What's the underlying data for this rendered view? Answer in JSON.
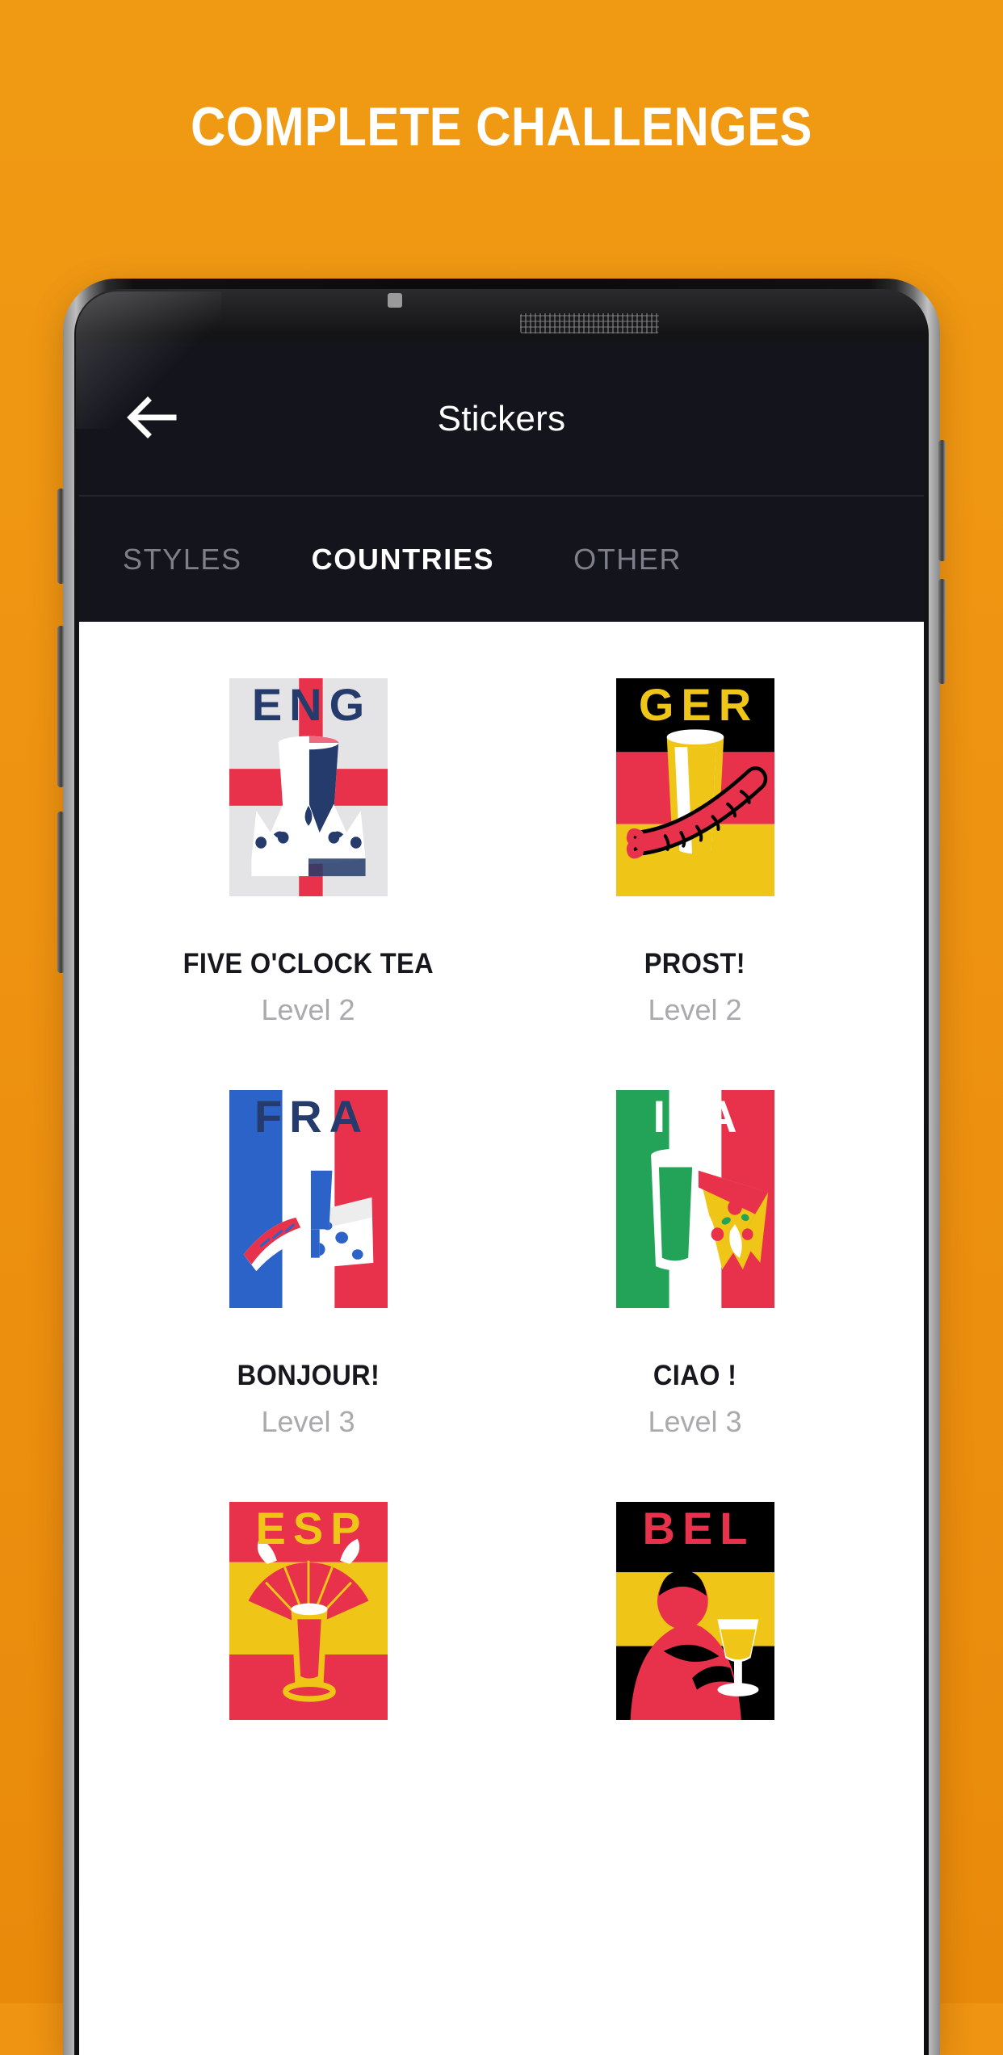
{
  "promo": {
    "headline": "COMPLETE CHALLENGES",
    "background_color": "#EE9312"
  },
  "app_bar": {
    "back_icon": "arrow-left-icon",
    "title": "Stickers",
    "background_color": "#14151C"
  },
  "tabs": [
    {
      "label": "STYLES",
      "active": false
    },
    {
      "label": "COUNTRIES",
      "active": true
    },
    {
      "label": "OTHER",
      "active": false
    }
  ],
  "stickers": [
    {
      "code": "ENG",
      "title": "FIVE O'CLOCK TEA",
      "level": "Level 2",
      "border_color": "#253B6B",
      "code_color": "#253B6B",
      "flag": "england",
      "bg_color": "#E4E4E6",
      "accent_color": "#E8324B"
    },
    {
      "code": "GER",
      "title": "PROST!",
      "level": "Level 2",
      "border_color": "#000000",
      "code_color": "#EFC517",
      "flag": "germany",
      "bg_color": "#000000",
      "accent_color": "#E8324B"
    },
    {
      "code": "FRA",
      "title": "BONJOUR!",
      "level": "Level 3",
      "border_color": "#253B6B",
      "code_color": "#253B6B",
      "flag": "france",
      "bg_color": "#2C63C8",
      "accent_color": "#E8324B"
    },
    {
      "code": "ITA",
      "title": "CIAO !",
      "level": "Level 3",
      "border_color": "#E8324B",
      "code_color": "#FFFFFF",
      "flag": "italy",
      "bg_color": "#22A357",
      "accent_color": "#E8324B"
    },
    {
      "code": "ESP",
      "title": "",
      "level": "",
      "border_color": "#F0A32A",
      "code_color": "#EFC517",
      "flag": "spain",
      "bg_color": "#E8324B",
      "accent_color": "#EFC517"
    },
    {
      "code": "BEL",
      "title": "",
      "level": "",
      "border_color": "#000000",
      "code_color": "#E8324B",
      "flag": "belgium",
      "bg_color": "#000000",
      "accent_color": "#EFC517"
    }
  ]
}
